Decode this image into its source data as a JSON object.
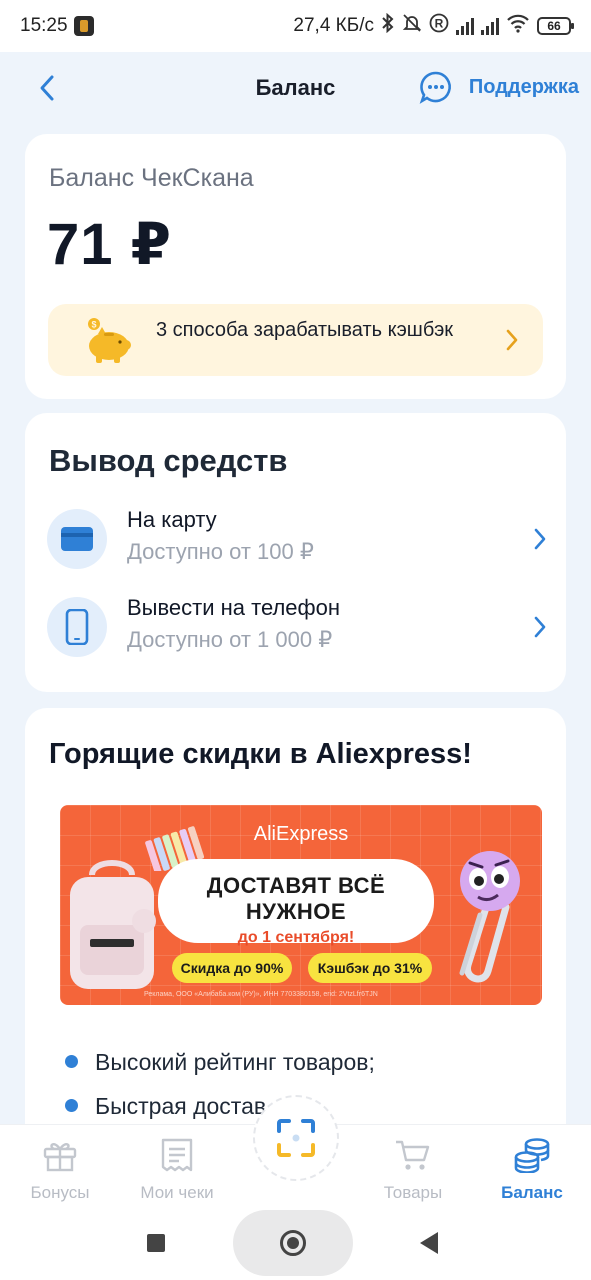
{
  "status_bar": {
    "time": "15:25",
    "net_speed": "27,4 КБ/с",
    "battery": "66"
  },
  "header": {
    "title": "Баланс",
    "support_label": "Поддержка"
  },
  "balance_card": {
    "label": "Баланс ЧекСкана",
    "value": "71 ₽",
    "promo_text": "3 способа зарабатывать кэшбэк"
  },
  "withdraw": {
    "title": "Вывод средств",
    "options": [
      {
        "title": "На карту",
        "subtitle": "Доступно от 100 ₽",
        "icon": "card-icon"
      },
      {
        "title": "Вывести на телефон",
        "subtitle": "Доступно от 1 000 ₽",
        "icon": "phone-icon"
      }
    ]
  },
  "hot_deals": {
    "title": "Горящие скидки в Aliexpress!",
    "banner": {
      "brand": "AliExpress",
      "headline": "ДОСТАВЯТ ВСЁ НУЖНОЕ",
      "subline": "до 1 сентября!",
      "pill_discount": "Скидка до 90%",
      "pill_cashback": "Кэшбэк до 31%",
      "legal": "Реклама, ООО «Алибаба.ком (РУ)», ИНН 7703380158, erid: 2VtzLfr6TJN"
    },
    "bullets": [
      "Высокий рейтинг товаров;",
      "Быстрая достав"
    ]
  },
  "bottom_nav": {
    "items": [
      {
        "label": "Бонусы",
        "icon": "gift-icon",
        "active": false
      },
      {
        "label": "Мои чеки",
        "icon": "receipt-icon",
        "active": false
      },
      {
        "label": "Товары",
        "icon": "cart-icon",
        "active": false
      },
      {
        "label": "Баланс",
        "icon": "coins-icon",
        "active": true
      }
    ],
    "scan_icon": "scan-icon"
  },
  "colors": {
    "accent": "#2f80d6",
    "background": "#eef4fb",
    "promo_bg": "#fff5de",
    "banner_orange": "#f4653a",
    "pill_yellow": "#f8e340"
  }
}
